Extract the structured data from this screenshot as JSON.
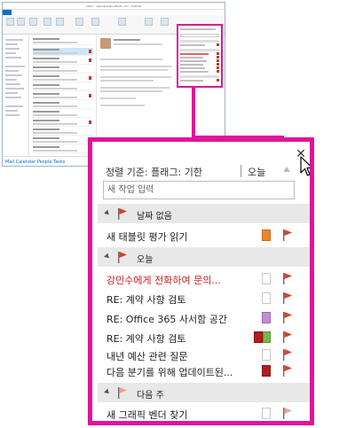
{
  "window": {
    "title": "Inbox - username@outlook.com - Outlook",
    "statusbar": "Mail  Calendar  People  Tasks"
  },
  "todo": {
    "close_glyph": "✕",
    "sort_label": "정렬 기준: 플래그: 기한",
    "sort_value": "오늘",
    "new_task_placeholder": "새 작업 입력",
    "groups": [
      {
        "label": "날짜 없음",
        "tasks": [
          {
            "name": "새 태블릿 평가 읽기",
            "category_color": "#f0832e"
          }
        ]
      },
      {
        "label": "오늘",
        "tasks": [
          {
            "name": "강민수에게 전화하여 문의...",
            "overdue": true
          },
          {
            "name": "RE: 계약 사항 검토"
          },
          {
            "name": "RE: Office 365 사서함 공간",
            "category_color": "#c28ed3"
          },
          {
            "name": "RE: 계약 사항 검토",
            "category_color": "#b01e1e",
            "category_color_2": "#7ab648"
          },
          {
            "name": "내년 예산 관련 질문"
          },
          {
            "name": "다음 분기를 위해 업데이트된...",
            "category_color": "#b01e1e"
          }
        ]
      },
      {
        "label": "다음 주",
        "tasks": [
          {
            "name": "새 그래픽 벤더 찾기",
            "flag_light": true
          }
        ]
      }
    ]
  },
  "colors": {
    "highlight": "#e0149b",
    "flag": "#d9412b",
    "flag_light": "#f1a08f",
    "overdue_text": "#d11a1a"
  }
}
